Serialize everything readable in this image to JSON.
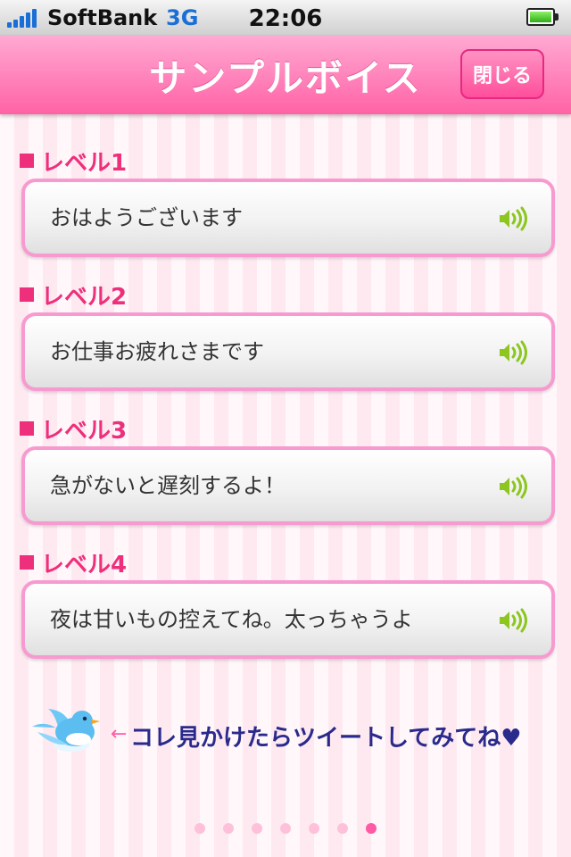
{
  "status_bar": {
    "carrier": "SoftBank",
    "network": "3G",
    "time": "22:06"
  },
  "header": {
    "title": "サンプルボイス",
    "close_label": "閉じる"
  },
  "levels": [
    {
      "label": "レベル1",
      "text": "おはようございます"
    },
    {
      "label": "レベル2",
      "text": "お仕事お疲れさまです"
    },
    {
      "label": "レベル3",
      "text": "急がないと遅刻するよ！"
    },
    {
      "label": "レベル4",
      "text": "夜は甘いもの控えてね。太っちゃうよ"
    }
  ],
  "tweet": {
    "arrow": "←",
    "text": "コレ見かけたらツイートしてみてね",
    "heart": "♥"
  },
  "pagination": {
    "count": 7,
    "active_index": 6
  },
  "colors": {
    "accent_pink": "#ff5aa5",
    "label_pink": "#ee2f7c",
    "speaker_green": "#8cc61e",
    "tweet_navy": "#2a2a8c"
  },
  "icons": {
    "speaker": "speaker-icon",
    "bird": "bird-icon",
    "battery": "battery-icon",
    "signal": "signal-icon"
  }
}
